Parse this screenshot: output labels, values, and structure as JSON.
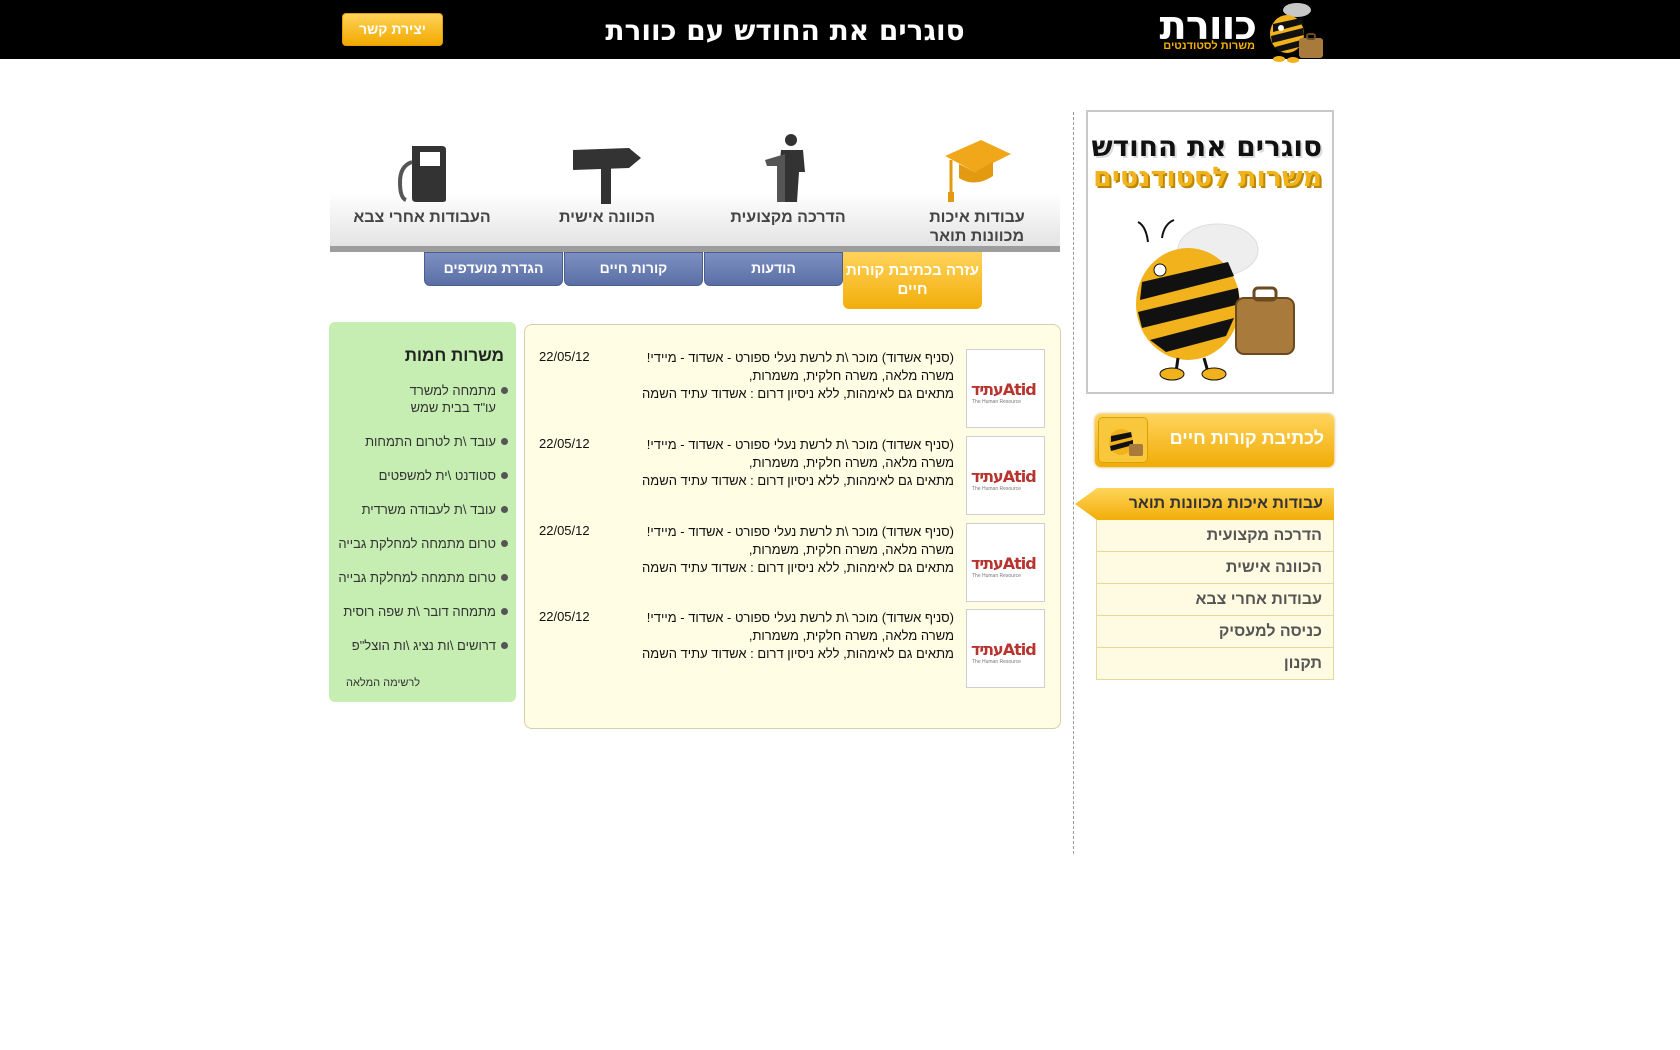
{
  "header": {
    "logo_text": "כוורת",
    "logo_sub": "משרות לסטודנטים",
    "slogan": "סוגרים את החודש עם כוורת",
    "contact_label": "יצירת קשר"
  },
  "promo": {
    "title": "סוגרים את החודש",
    "subtitle": "משרות לסטודנטים"
  },
  "cv_button": {
    "label": "לכתיבת קורות חיים"
  },
  "side_menu": [
    {
      "label": "עבודות איכות מכוונות תואר",
      "active": true
    },
    {
      "label": "הדרכה מקצועית"
    },
    {
      "label": "הכוונה אישית"
    },
    {
      "label": "עבודות אחרי צבא"
    },
    {
      "label": "כניסה למעסיק"
    },
    {
      "label": "תקנון"
    }
  ],
  "categories": [
    {
      "label": "עבודות איכות מכוונות תואר",
      "icon": "graduation-cap-icon"
    },
    {
      "label": "הדרכה מקצועית",
      "icon": "lecturer-icon"
    },
    {
      "label": "הכוונה אישית",
      "icon": "signpost-icon"
    },
    {
      "label": "העבודות אחרי צבא",
      "icon": "fuel-pump-icon"
    }
  ],
  "tabs": {
    "cv_help": "עזרה בכתיבת קורות חיים",
    "messages": "הודעות",
    "resume": "קורות חיים",
    "preferences": "הגדרת מועדפים"
  },
  "jobs": [
    {
      "logo": "עתידAtid",
      "logo_tag": "The Human Resource",
      "line1": "(סניף אשדוד) מוכר \\ת לרשת נעלי ספורט - אשדוד - מיידי!",
      "line2": "משרה מלאה, משרה חלקית, משמרות,",
      "line3": "מתאים גם לאימהות, ללא ניסיון דרום : אשדוד  עתיד השמה",
      "date": "22/05/12"
    },
    {
      "logo": "עתידAtid",
      "logo_tag": "The Human Resource",
      "line1": "(סניף אשדוד) מוכר \\ת לרשת נעלי ספורט - אשדוד - מיידי!",
      "line2": "משרה מלאה, משרה חלקית, משמרות,",
      "line3": "מתאים גם לאימהות, ללא ניסיון דרום : אשדוד  עתיד השמה",
      "date": "22/05/12"
    },
    {
      "logo": "עתידAtid",
      "logo_tag": "The Human Resource",
      "line1": "(סניף אשדוד) מוכר \\ת לרשת נעלי ספורט - אשדוד - מיידי!",
      "line2": "משרה מלאה, משרה חלקית, משמרות,",
      "line3": "מתאים גם לאימהות, ללא ניסיון דרום : אשדוד  עתיד השמה",
      "date": "22/05/12"
    },
    {
      "logo": "עתידAtid",
      "logo_tag": "The Human Resource",
      "line1": "(סניף אשדוד) מוכר \\ת לרשת נעלי ספורט - אשדוד - מיידי!",
      "line2": "משרה מלאה, משרה חלקית, משמרות,",
      "line3": "מתאים גם לאימהות, ללא ניסיון דרום : אשדוד  עתיד השמה",
      "date": "22/05/12"
    }
  ],
  "hot_jobs": {
    "title": "משרות חמות",
    "items": [
      "מתמחה למשרד עו\"ד בבית שמש",
      "עובד \\ת לטרום התמחות",
      "סטודנט \\ית למשפטים",
      "עובד \\ת לעבודה משרדית",
      "טרום מתמחה למחלקת גבייה",
      "טרום מתמחה למחלקת גבייה",
      "מתמחה דובר \\ת שפה רוסית",
      "דרושים \\ות נציג \\ות הוצל\"פ"
    ],
    "more_link": "לרשימה המלאה"
  }
}
